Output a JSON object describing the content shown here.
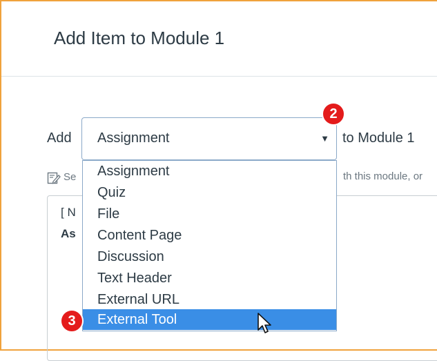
{
  "dialog": {
    "title": "Add Item to Module 1"
  },
  "form": {
    "add_label": "Add",
    "selected_type": "Assignment",
    "to_label": "to Module 1",
    "dropdown_arrow": "▼",
    "left_partial_text": "Se",
    "right_partial_text": "th this module, or"
  },
  "dropdown_options": [
    "Assignment",
    "Quiz",
    "File",
    "Content Page",
    "Discussion",
    "Text Header",
    "External URL",
    "External Tool"
  ],
  "highlighted_option": "External Tool",
  "box": {
    "line1": "[ N",
    "line2": "As"
  },
  "step_badges": {
    "step_2": "2",
    "step_3": "3"
  },
  "colors": {
    "border_accent": "#f0a23c",
    "badge": "#e41b1b",
    "highlight": "#3a8ee6"
  },
  "icons": [
    "edit-icon",
    "mouse-pointer-icon",
    "chevron-down-icon"
  ]
}
